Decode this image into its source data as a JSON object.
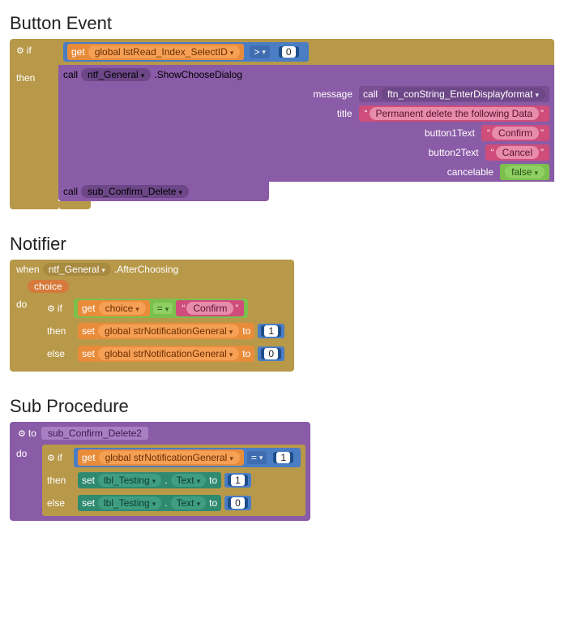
{
  "headings": {
    "s1": "Button Event",
    "s2": "Notifier",
    "s3": "Sub Procedure"
  },
  "common": {
    "if": "if",
    "then": "then",
    "else": "else",
    "do": "do",
    "get": "get",
    "set": "set",
    "to_kw": "to",
    "call": "call",
    "when": "when",
    "gt": ">",
    "eq": "="
  },
  "s1": {
    "get_var": "global lstRead_Index_SelectID",
    "cmp_num": "0",
    "call1_target": "ntf_General",
    "call1_method": ".ShowChooseDialog",
    "args": {
      "message_label": "message",
      "message_call": "ftn_conString_EnterDisplayformat",
      "title_label": "title",
      "title_text": "Permanent delete the following Data",
      "b1_label": "button1Text",
      "b1_text": "Confirm",
      "b2_label": "button2Text",
      "b2_text": "Cancel",
      "cancel_label": "cancelable",
      "cancel_val": "false"
    },
    "call2_target": "sub_Confirm_Delete"
  },
  "s2": {
    "when_target": "ntf_General",
    "when_event": ".AfterChoosing",
    "choice_param": "choice",
    "get_var": "choice",
    "cmp_text": "Confirm",
    "set_var": "global strNotificationGeneral",
    "then_num": "1",
    "else_num": "0"
  },
  "s3": {
    "to_kw": "to",
    "proc_name": "sub_Confirm_Delete2",
    "get_var": "global strNotificationGeneral",
    "cmp_num": "1",
    "component": "lbl_Testing",
    "property": "Text",
    "then_num": "1",
    "else_num": "0"
  }
}
